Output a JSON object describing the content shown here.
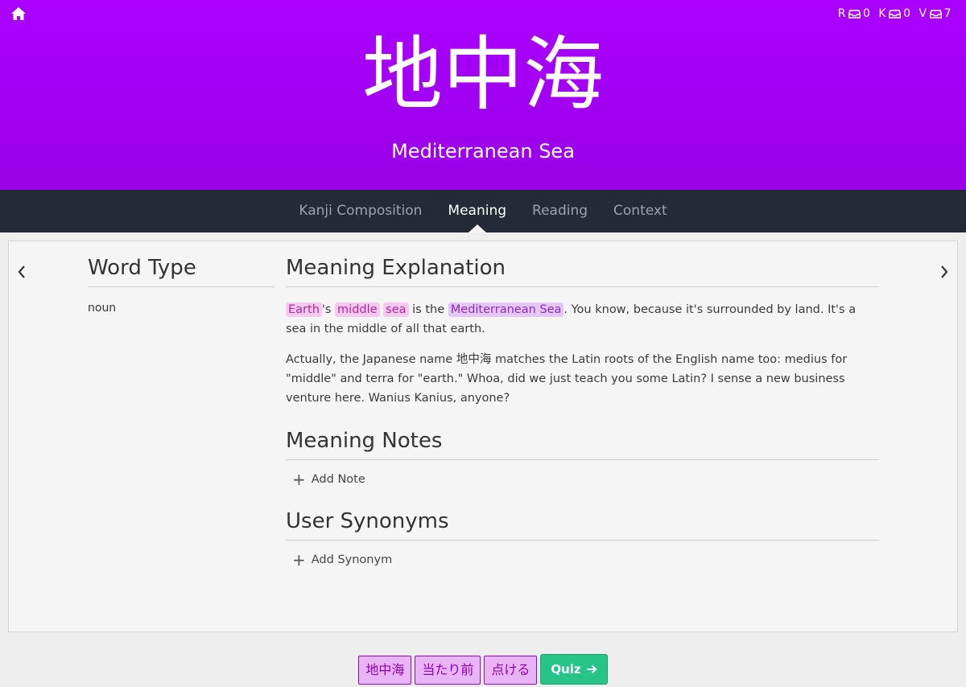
{
  "header": {
    "character": "地中海",
    "meaning": "Mediterranean Sea",
    "counters": [
      {
        "letter": "R",
        "count": "0"
      },
      {
        "letter": "K",
        "count": "0"
      },
      {
        "letter": "V",
        "count": "7"
      }
    ],
    "bg_color": "#aa00ff"
  },
  "nav": {
    "tabs": [
      {
        "label": "Kanji Composition",
        "active": false
      },
      {
        "label": "Meaning",
        "active": true
      },
      {
        "label": "Reading",
        "active": false
      },
      {
        "label": "Context",
        "active": false
      }
    ]
  },
  "word_type": {
    "heading": "Word Type",
    "value": "noun"
  },
  "meaning_explanation": {
    "heading": "Meaning Explanation",
    "p1": {
      "earth": "Earth",
      "apostrophe_s": "'s",
      "middle": "middle",
      "sea": "sea",
      "is_the": "is the",
      "vocab": "Mediterranean Sea",
      "rest": ". You know, because it's surrounded by land. It's a sea in the middle of all that earth."
    },
    "p2": "Actually, the Japanese name 地中海 matches the Latin roots of the English name too: medius for \"middle\" and terra for \"earth.\" Whoa, did we just teach you some Latin? I sense a new business venture here. Wanius Kanius, anyone?"
  },
  "meaning_notes": {
    "heading": "Meaning Notes",
    "add_label": "Add Note"
  },
  "user_synonyms": {
    "heading": "User Synonyms",
    "add_label": "Add Synonym"
  },
  "bottom": {
    "related": [
      "地中海",
      "当たり前",
      "点ける"
    ],
    "quiz_label": "Quiz"
  },
  "icons": {
    "home": "home-icon",
    "prev": "chevron-left-icon",
    "next": "chevron-right-icon",
    "tray": "tray-icon",
    "plus": "plus-icon",
    "arrow": "arrow-right-icon"
  }
}
